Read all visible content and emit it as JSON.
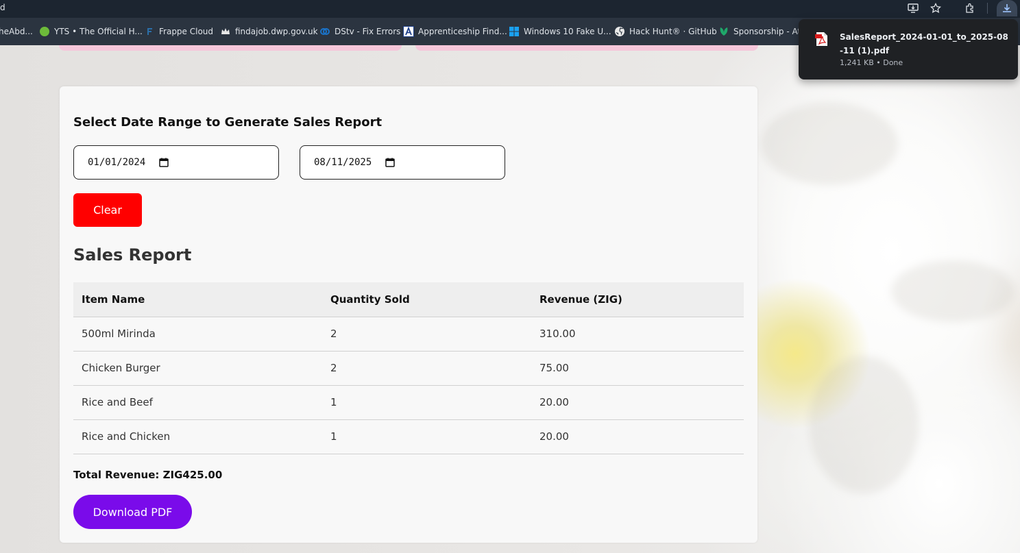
{
  "browser": {
    "url_fragment": "d",
    "bookmarks": [
      {
        "label": "heAbd..."
      },
      {
        "label": "YTS • The Official H..."
      },
      {
        "label": "Frappe Cloud"
      },
      {
        "label": "findajob.dwp.gov.uk"
      },
      {
        "label": "DStv - Fix Errors"
      },
      {
        "label": "Apprenticeship Find..."
      },
      {
        "label": "Windows 10 Fake U..."
      },
      {
        "label": "Hack Hunt® · GitHub"
      },
      {
        "label": "Sponsorship - Ath"
      }
    ],
    "icons": [
      "install-app-icon",
      "bookmark-star-icon",
      "extensions-icon",
      "download-icon"
    ]
  },
  "download_popup": {
    "filename": "SalesReport_2024-01-01_to_2025-08-11 (1).pdf",
    "meta": "1,241 KB • Done"
  },
  "report": {
    "heading": "Select Date Range to Generate Sales Report",
    "start_date": "01/01/2024",
    "end_date": "08/11/2025",
    "clear_label": "Clear",
    "title": "Sales Report",
    "columns": [
      "Item Name",
      "Quantity Sold",
      "Revenue (ZIG)"
    ],
    "rows": [
      {
        "item": "500ml Mirinda",
        "quantity": "2",
        "revenue": "310.00"
      },
      {
        "item": "Chicken Burger",
        "quantity": "2",
        "revenue": "75.00"
      },
      {
        "item": "Rice and Beef",
        "quantity": "1",
        "revenue": "20.00"
      },
      {
        "item": "Rice and Chicken",
        "quantity": "1",
        "revenue": "20.00"
      }
    ],
    "total": "Total Revenue: ZIG425.00",
    "download_label": "Download PDF"
  },
  "colors": {
    "clear_button": "#ff0000",
    "download_button": "#7a0bea",
    "browser_bar": "#1c2530",
    "bookmark_bar": "#2b3440"
  }
}
